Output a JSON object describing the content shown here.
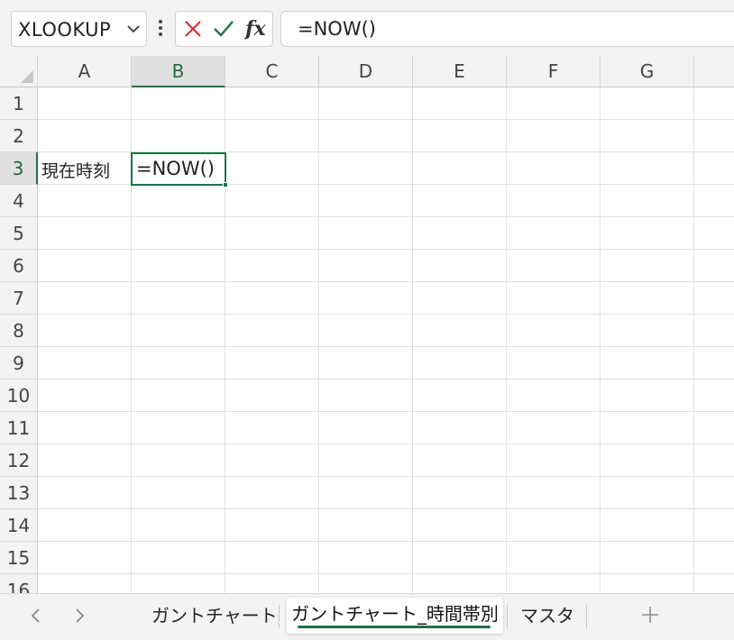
{
  "formula_bar": {
    "name_box": "XLOOKUP",
    "formula": "=NOW()"
  },
  "columns": [
    "A",
    "B",
    "C",
    "D",
    "E",
    "F",
    "G"
  ],
  "rows": [
    "1",
    "2",
    "3",
    "4",
    "5",
    "6",
    "7",
    "8",
    "9",
    "10",
    "11",
    "12",
    "13",
    "14",
    "15",
    "16"
  ],
  "active_cell": {
    "column": "B",
    "row": "3"
  },
  "cells": {
    "A3": "現在時刻",
    "B3": "=NOW()"
  },
  "sheet_tabs": [
    {
      "label": "ガントチャート",
      "active": false
    },
    {
      "label": "ガントチャート_時間帯別",
      "active": true
    },
    {
      "label": "マスタ",
      "active": false
    }
  ],
  "icons": {
    "name_box_dropdown": "chevron-down-icon",
    "more": "vertical-ellipsis-icon",
    "cancel": "x-icon",
    "enter": "checkmark-icon",
    "function": "fx-icon",
    "prev_sheet": "chevron-left-icon",
    "next_sheet": "chevron-right-icon",
    "add_sheet": "plus-icon"
  },
  "colors": {
    "accent": "#1e7145",
    "cancel": "#d13438",
    "header_bg": "#f3f3f3"
  }
}
